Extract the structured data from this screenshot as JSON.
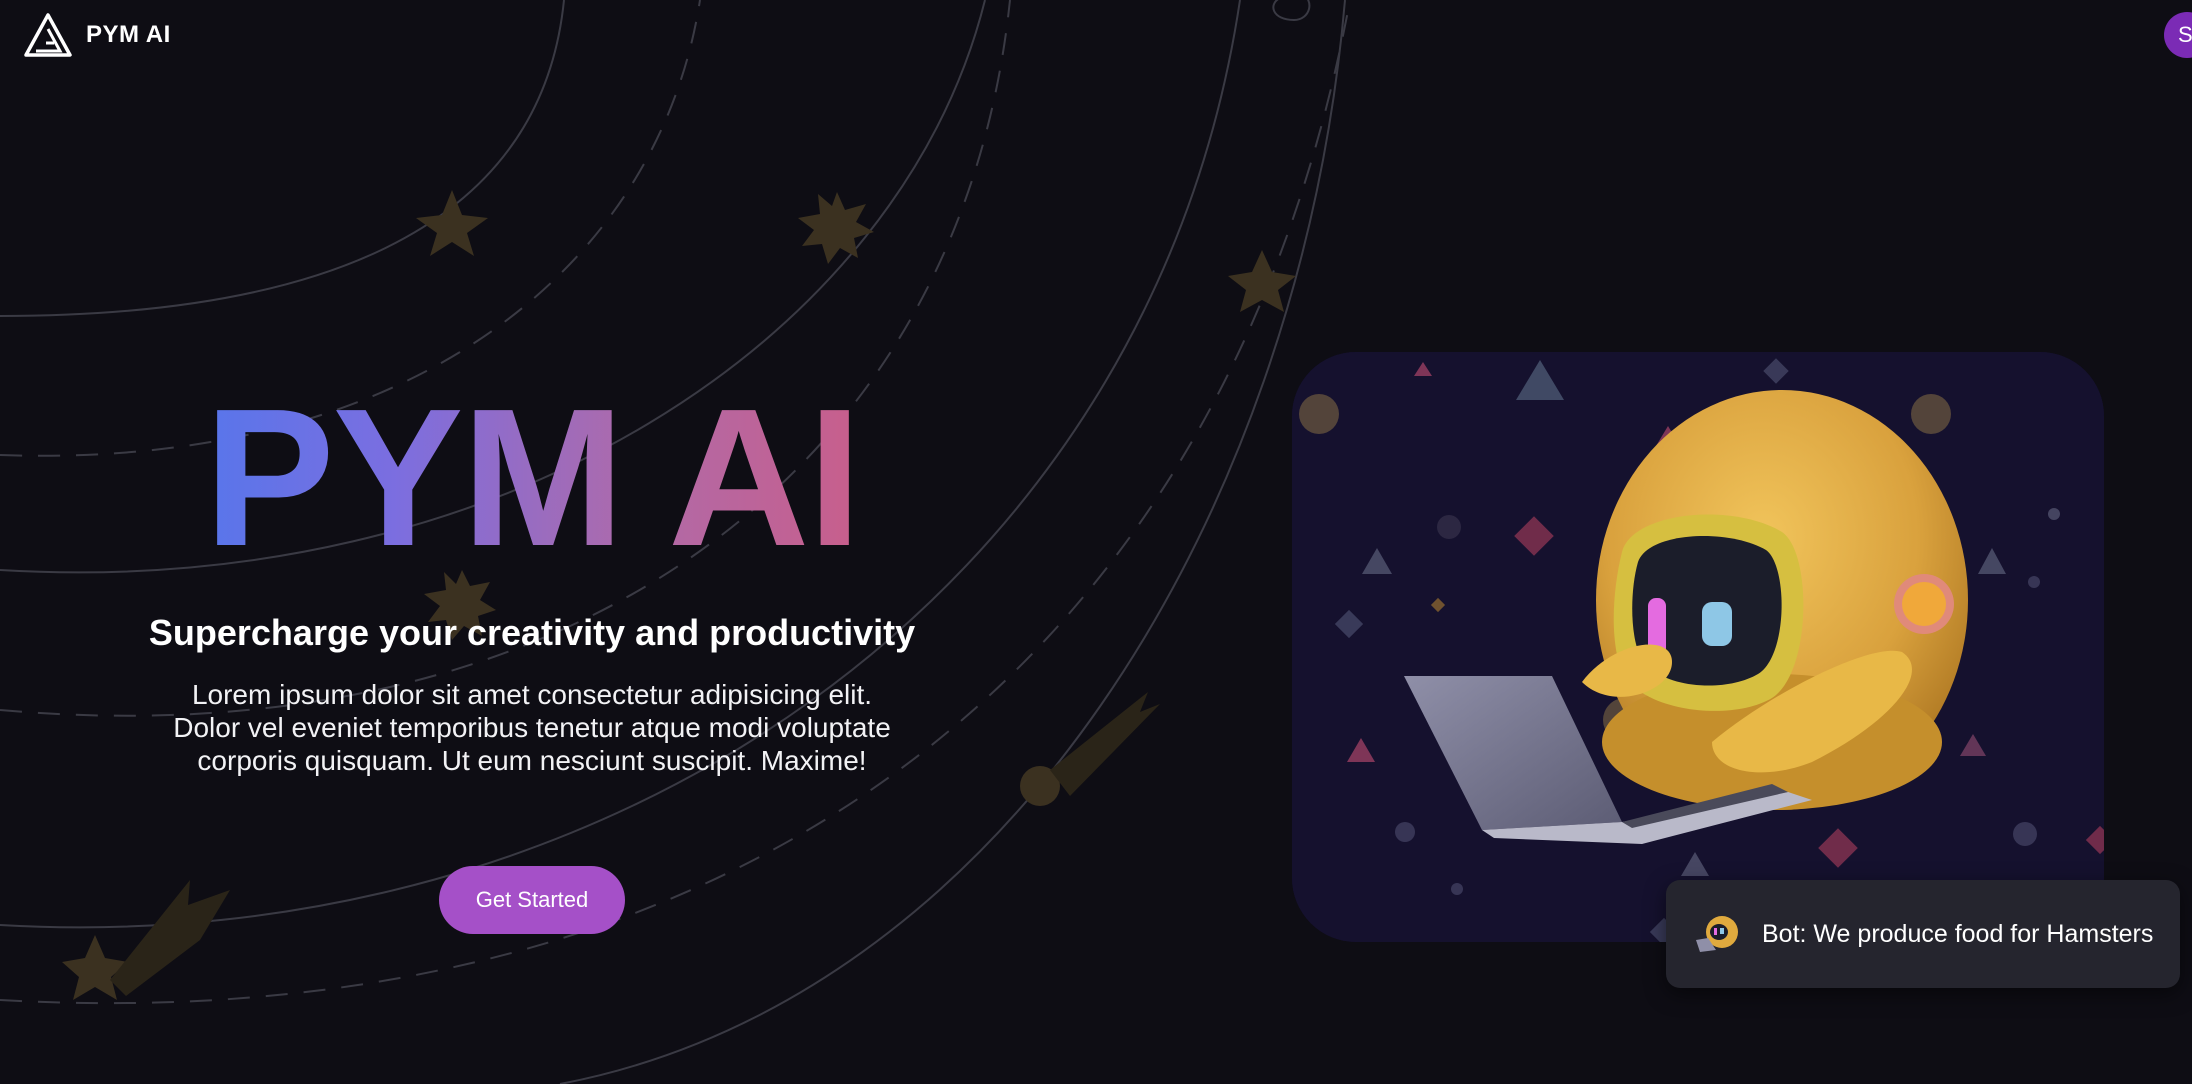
{
  "header": {
    "brand_name": "PYM AI",
    "logo_icon": "triangle-logo-icon",
    "avatar_initial": "S"
  },
  "hero": {
    "title": "PYM AI",
    "subtitle": "Supercharge your creativity and productivity",
    "description": "Lorem ipsum dolor sit amet consectetur adipisicing elit. Dolor vel eveniet temporibus tenetur atque modi voluptate corporis quisquam. Ut eum nesciunt suscipit. Maxime!",
    "cta_label": "Get Started"
  },
  "illustration": {
    "subject": "robot-using-laptop-illustration"
  },
  "chat_toast": {
    "message": "Bot: We produce food for Hamsters",
    "icon": "bot-robot-icon"
  },
  "colors": {
    "background": "#0e0d14",
    "title_gradient_start": "#3f7bf2",
    "title_gradient_end": "#d7577a",
    "cta": "#a550c8",
    "avatar": "#7b2bb5",
    "toast": "#25252e",
    "illustration_bg": "#15112e"
  }
}
